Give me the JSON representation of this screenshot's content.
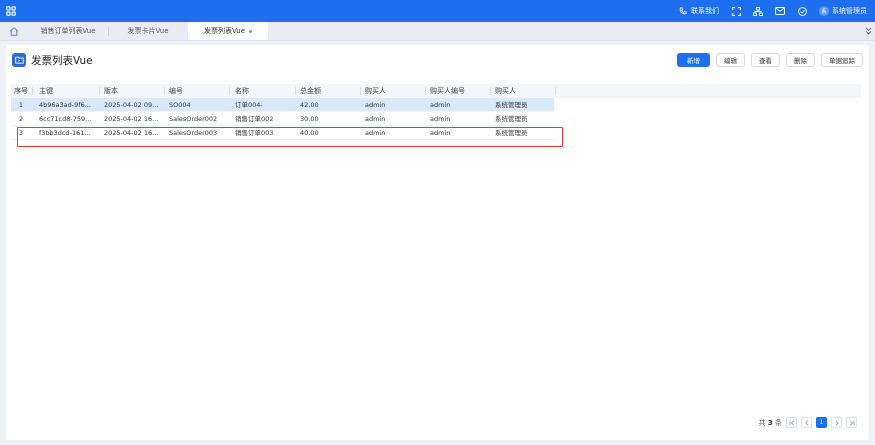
{
  "header": {
    "contact_label": "联系我们",
    "user_avatar": "系",
    "user_name": "系统管理员",
    "brand_color": "#1e6ff0"
  },
  "tabs": [
    {
      "label": "销售订单列表Vue"
    },
    {
      "label": "发票卡片Vue"
    },
    {
      "label": "发票列表Vue",
      "active": true
    }
  ],
  "page": {
    "title": "发票列表Vue",
    "actions": {
      "add": "新增",
      "edit": "编辑",
      "view": "查看",
      "delete": "删除",
      "trace": "单据追踪"
    }
  },
  "table": {
    "columns": [
      "序号",
      "主键",
      "版本",
      "编号",
      "名称",
      "总金额",
      "购买人",
      "购买人编号",
      "购买人"
    ],
    "rows": [
      [
        "1",
        "4b96a3ad-9f6...",
        "2025-04-02 09...",
        "SO004",
        "订单004-",
        "42.00",
        "admin",
        "admin",
        "系统管理员"
      ],
      [
        "2",
        "6cc71cd8-759...",
        "2025-04-02 16...",
        "SalesOrder002",
        "销售订单002",
        "30.00",
        "admin",
        "admin",
        "系统管理员"
      ],
      [
        "3",
        "f3bb3dcd-161...",
        "2025-04-02 16...",
        "SalesOrder003",
        "销售订单003",
        "40.00",
        "admin",
        "admin",
        "系统管理员"
      ]
    ],
    "selected_row": 1,
    "highlighted_row": 3
  },
  "pagination": {
    "prefix": "共",
    "total": "3",
    "suffix": "条",
    "current_page": "1"
  }
}
